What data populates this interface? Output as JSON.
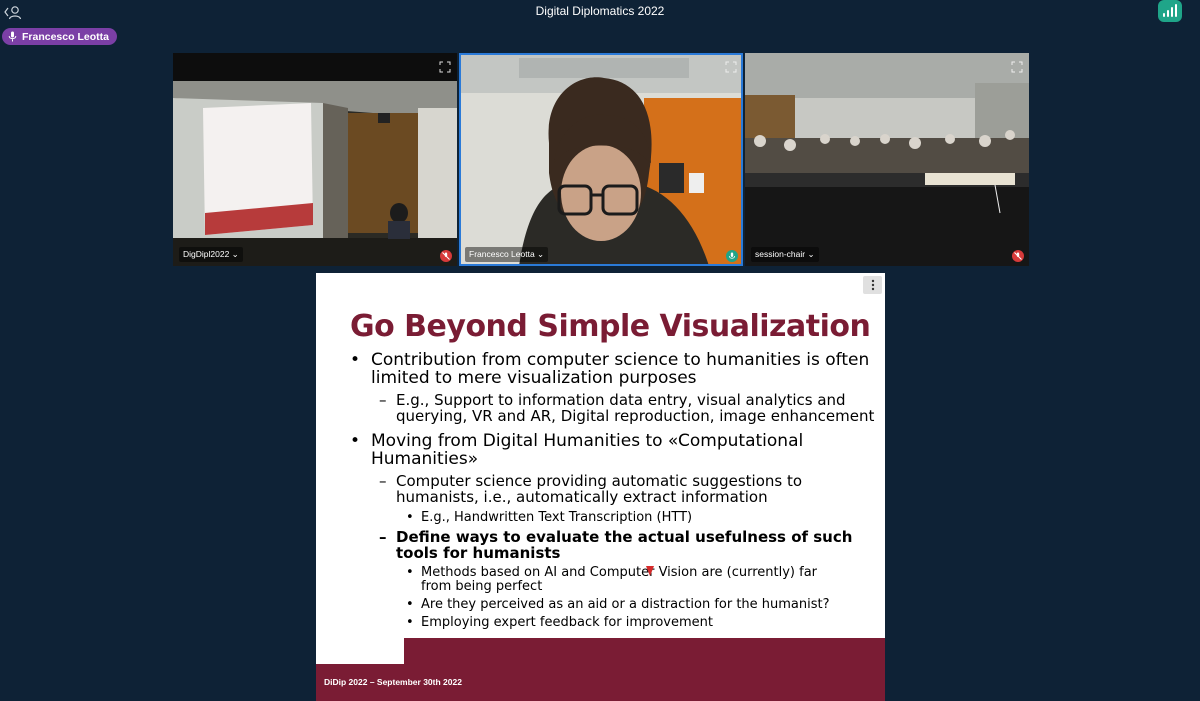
{
  "header": {
    "title": "Digital Diplomatics 2022"
  },
  "active_speaker": {
    "name": "Francesco Leotta"
  },
  "tiles": [
    {
      "name": "DigDipl2022",
      "mic": "muted"
    },
    {
      "name": "Francesco Leotta",
      "mic": "on"
    },
    {
      "name": "session-chair",
      "mic": "muted"
    }
  ],
  "slide": {
    "title": "Go Beyond Simple Visualization",
    "bullets": [
      {
        "level": 1,
        "text": "Contribution from computer science to humanities is often limited to mere visualization purposes"
      },
      {
        "level": 2,
        "text": "E.g., Support to information data entry, visual analytics and querying, VR and AR, Digital reproduction, image enhancement"
      },
      {
        "level": 1,
        "text": "Moving from Digital Humanities to «Computational Humanities»"
      },
      {
        "level": 2,
        "text": "Computer science providing automatic suggestions to humanists, i.e., automatically extract information"
      },
      {
        "level": 3,
        "text": "E.g., Handwritten Text Transcription (HTT)"
      },
      {
        "level": 2,
        "text": "Define ways to evaluate the actual usefulness of such tools for humanists",
        "bold": true
      },
      {
        "level": 3,
        "text": "Methods based on AI and Computer Vision are (currently) far from being perfect"
      },
      {
        "level": 3,
        "text": "Are they perceived as an aid or a distraction for the humanist?"
      },
      {
        "level": 3,
        "text": "Employing expert feedback for improvement"
      }
    ],
    "footer": "DiDip 2022 – September 30th 2022"
  },
  "colors": {
    "background": "#0e2236",
    "accent": "#7a1c34",
    "speaker_chip": "#7b3fa6",
    "active_border": "#2a7ad8",
    "signal": "#1fa589"
  }
}
